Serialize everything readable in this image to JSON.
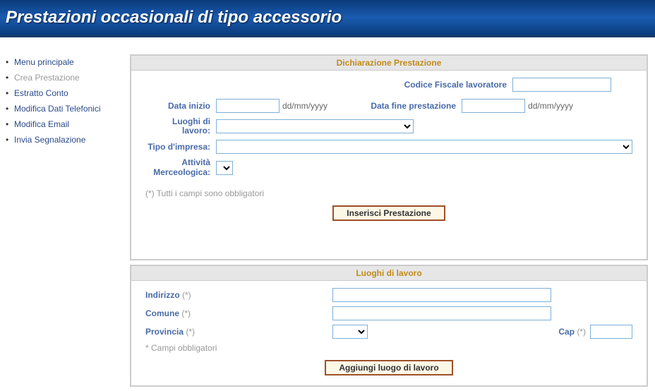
{
  "header": {
    "title": "Prestazioni occasionali di tipo accessorio"
  },
  "sidebar": {
    "items": [
      {
        "label": "Menu principale",
        "active": false
      },
      {
        "label": "Crea Prestazione",
        "active": true
      },
      {
        "label": "Estratto Conto",
        "active": false
      },
      {
        "label": "Modifica Dati Telefonici",
        "active": false
      },
      {
        "label": "Modifica Email",
        "active": false
      },
      {
        "label": "Invia Segnalazione",
        "active": false
      }
    ]
  },
  "panel1": {
    "title": "Dichiarazione Prestazione",
    "codice_fiscale_label": "Codice Fiscale lavoratore",
    "data_inizio_label": "Data inizio",
    "data_fine_label": "Data fine prestazione",
    "date_hint": "dd/mm/yyyy",
    "luoghi_lavoro_label": "Luoghi di lavoro:",
    "tipo_impresa_label": "Tipo d'impresa:",
    "attivita_label": "Attività Merceologica:",
    "mandatory_note": "(*) Tutti i campi sono obbligatori",
    "submit_label": "Inserisci Prestazione"
  },
  "panel2": {
    "title": "Luoghi di lavoro",
    "indirizzo_label": "Indirizzo",
    "comune_label": "Comune",
    "provincia_label": "Provincia",
    "cap_label": "Cap",
    "star": "(*)",
    "mandatory_note": "* Campi obbligatori",
    "submit_label": "Aggiungi luogo di lavoro"
  }
}
